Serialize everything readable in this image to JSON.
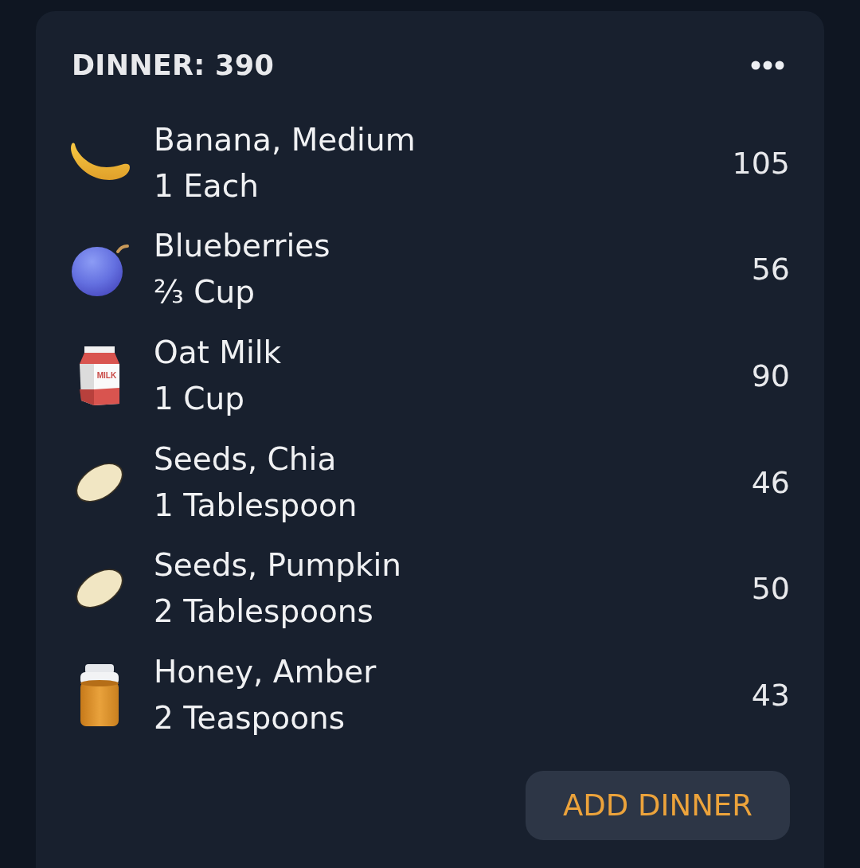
{
  "meal": {
    "title": "DINNER: 390"
  },
  "items": [
    {
      "kind": "banana",
      "name": "Banana, Medium",
      "amount": "1 Each",
      "calories": "105"
    },
    {
      "kind": "blueberry",
      "name": "Blueberries",
      "amount": "⅔ Cup",
      "calories": "56"
    },
    {
      "kind": "milk",
      "carton_label": "MILK",
      "name": "Oat Milk",
      "amount": "1 Cup",
      "calories": "90"
    },
    {
      "kind": "seed",
      "name": "Seeds, Chia",
      "amount": "1 Tablespoon",
      "calories": "46"
    },
    {
      "kind": "seed",
      "name": "Seeds, Pumpkin",
      "amount": "2 Tablespoons",
      "calories": "50"
    },
    {
      "kind": "honey",
      "name": "Honey, Amber",
      "amount": "2 Teaspoons",
      "calories": "43"
    }
  ],
  "add_button": {
    "label": "ADD DINNER"
  }
}
